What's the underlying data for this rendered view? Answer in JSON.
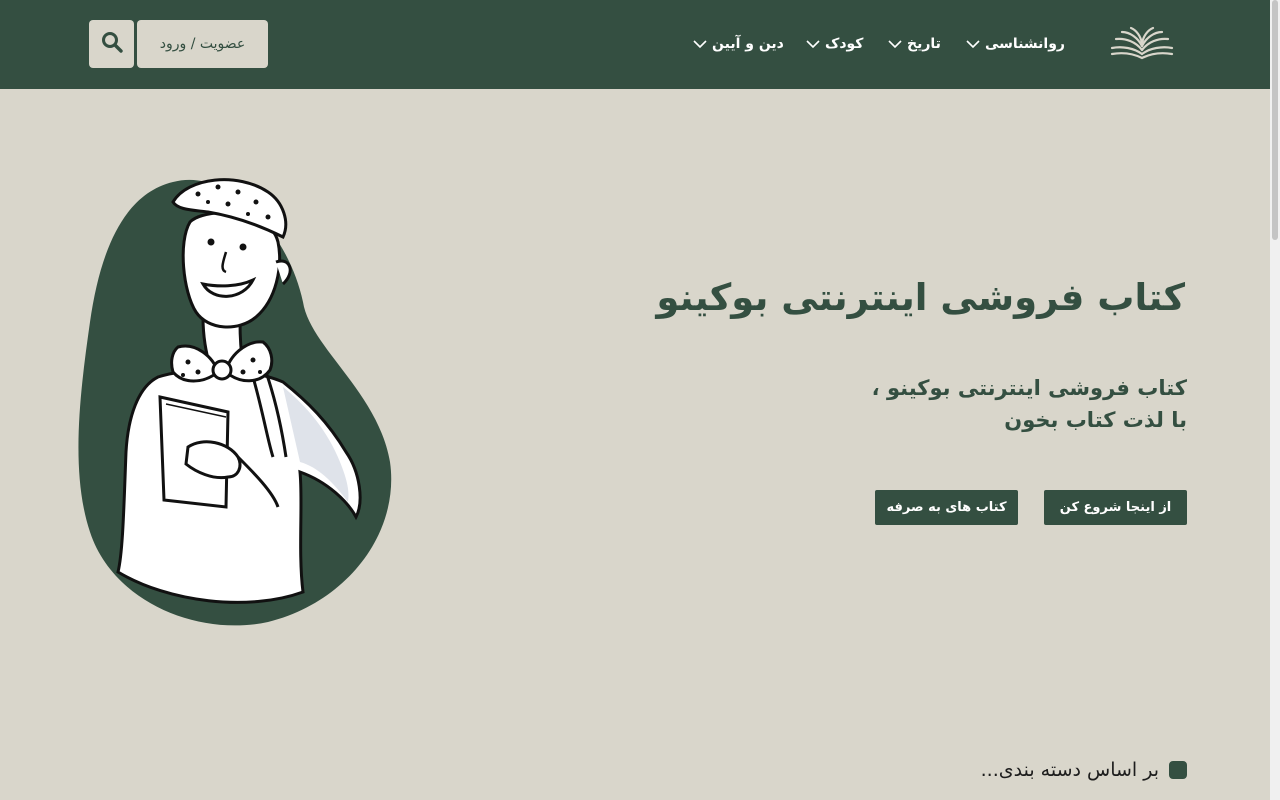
{
  "header": {
    "nav": [
      {
        "label": "روانشناسی"
      },
      {
        "label": "تاریخ"
      },
      {
        "label": "کودک"
      },
      {
        "label": "دین و آیین"
      }
    ],
    "login_label": "عضویت / ورود",
    "logo_icon": "open-book-icon",
    "search_icon": "search-icon"
  },
  "hero": {
    "title": "کتاب فروشی اینترنتی بوکینو",
    "subtitle_line1": "کتاب فروشی اینترنتی بوکینو ،",
    "subtitle_line2": "با لذت کتاب بخون",
    "start_button": "از اینجا شروع کن",
    "pages_button": "کتاب های به صرفه"
  },
  "categories": {
    "heading": "بر اساس دسته بندی..."
  },
  "colors": {
    "primary": "#344f41",
    "background": "#d9d6cb",
    "white": "#ffffff"
  }
}
